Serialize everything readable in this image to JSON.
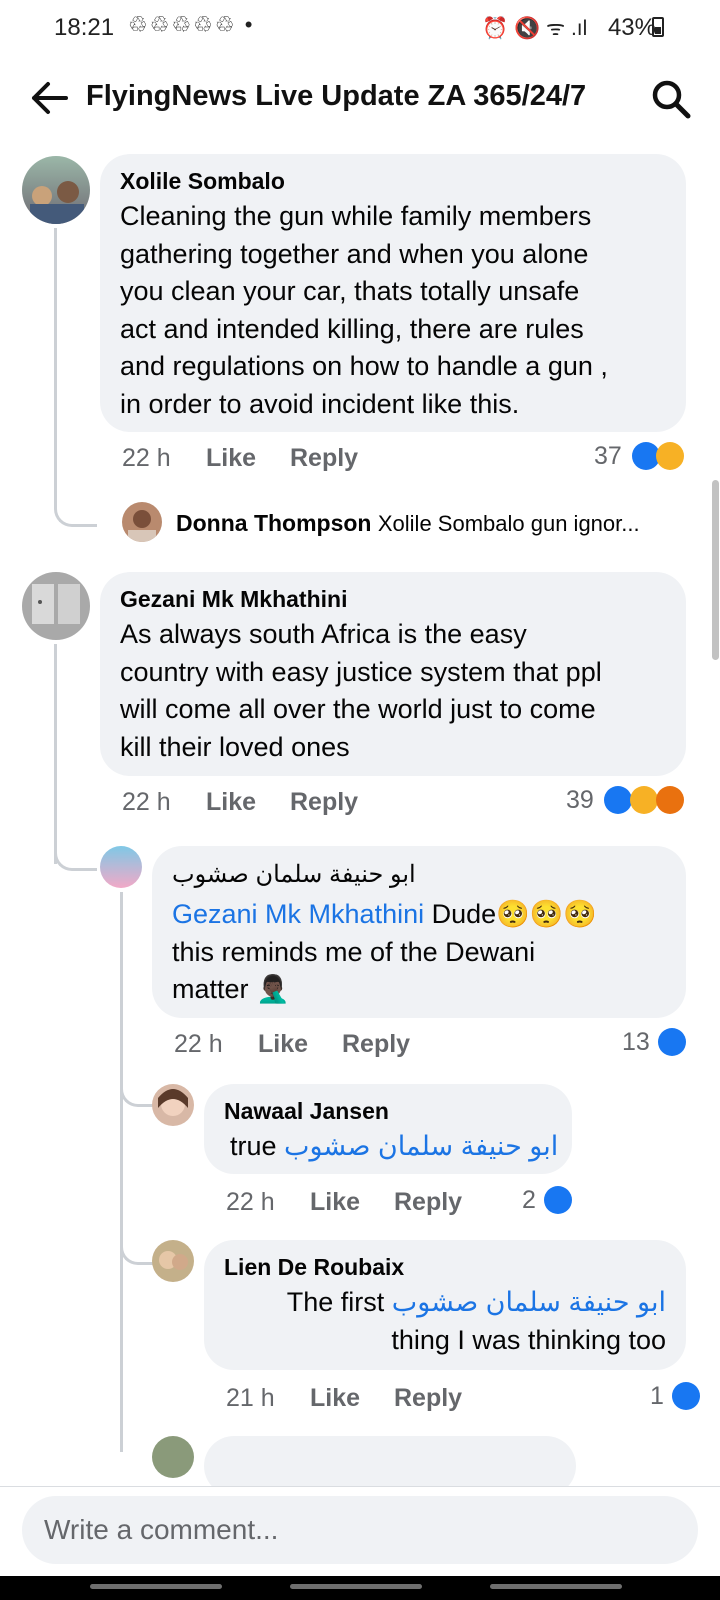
{
  "status_bar": {
    "time": "18:21",
    "notification_icons": "♲♲♲♲♲ •",
    "system_icons": "⏰ 🔇 ᯤ .ıl",
    "battery": "43%"
  },
  "header": {
    "title": "FlyingNews Live Update ZA 365/24/7",
    "back_icon": "arrow-left-icon",
    "search_icon": "search-icon"
  },
  "comments": [
    {
      "author": "Xolile Sombalo",
      "lines": [
        "Cleaning the gun while family members",
        "gathering together and when you alone",
        "you clean your car, thats totally unsafe",
        "act and intended killing,  there are rules",
        "and regulations on how to handle a gun ,",
        "in order to avoid incident like this."
      ],
      "time": "22 h",
      "like": "Like",
      "reply": "Reply",
      "reactions": "37"
    },
    {
      "author": "Donna Thompson",
      "preview": "Xolile Sombalo gun ignor..."
    },
    {
      "author": "Gezani Mk Mkhathini",
      "lines": [
        "As always south Africa is the easy",
        "country with easy justice system that ppl",
        "will come all over the world just to come",
        "kill their loved ones"
      ],
      "time": "22 h",
      "like": "Like",
      "reply": "Reply",
      "reactions": "39"
    },
    {
      "author": "ابو حنيفة سلمان صشوب",
      "mention": "Gezani Mk Mkhathini",
      "line1_after": " Dude🥺🥺🥺",
      "line2": "this reminds me of the Dewani",
      "line3": "matter 🤦🏿‍♂️",
      "time": "22 h",
      "like": "Like",
      "reply": "Reply",
      "reactions": "13"
    },
    {
      "author": "Nawaal Jansen",
      "prefix": "true ",
      "mention": "ابو حنيفة سلمان صشوب",
      "time": "22 h",
      "like": "Like",
      "reply": "Reply",
      "reactions": "2"
    },
    {
      "author": "Lien De Roubaix",
      "prefix": "The first ",
      "mention": "ابو حنيفة سلمان صشوب",
      "line2": "thing I was thinking too",
      "time": "21 h",
      "like": "Like",
      "reply": "Reply",
      "reactions": "1"
    }
  ],
  "composer": {
    "placeholder": "Write a comment..."
  },
  "colors": {
    "accent": "#1877f2",
    "bubble": "#f0f2f5",
    "meta": "#65676b"
  }
}
